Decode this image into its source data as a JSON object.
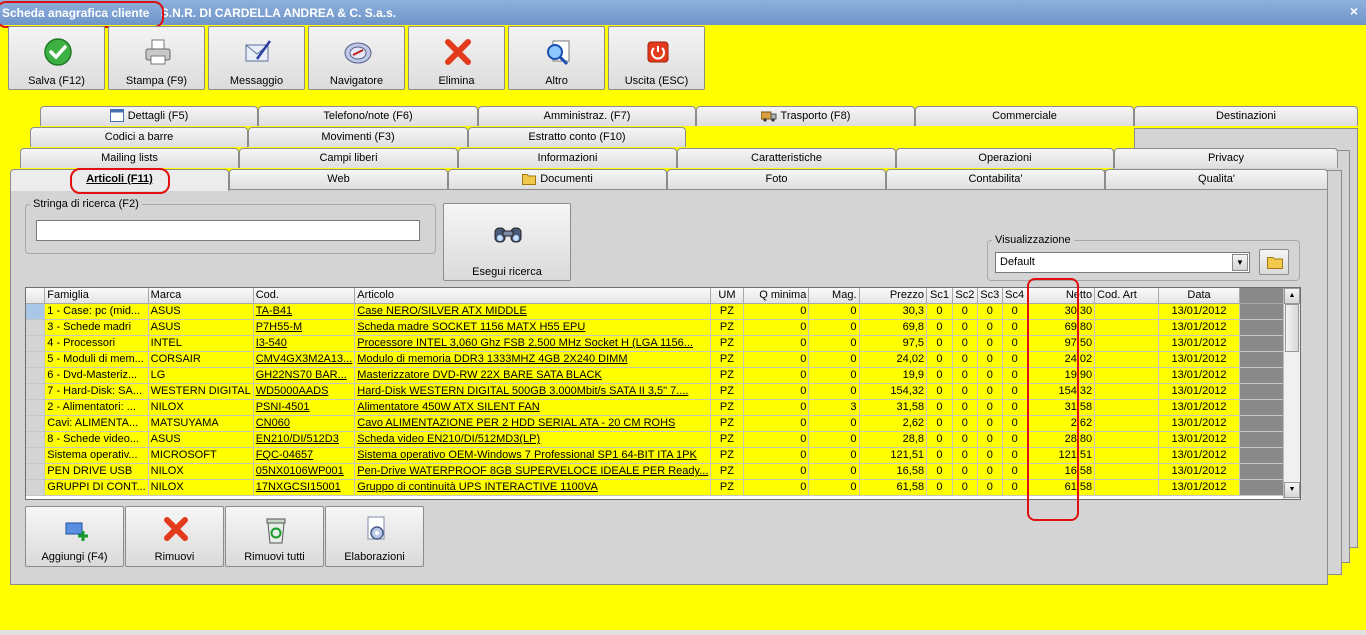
{
  "window": {
    "title": "Scheda anagrafica cliente",
    "company": "S.N.R. DI CARDELLA ANDREA & C. S.a.s.",
    "close_glyph": "×"
  },
  "toolbar": [
    {
      "label": "Salva (F12)",
      "icon": "checkmark-icon"
    },
    {
      "label": "Stampa (F9)",
      "icon": "printer-icon"
    },
    {
      "label": "Messaggio",
      "icon": "message-icon"
    },
    {
      "label": "Navigatore",
      "icon": "navigator-icon"
    },
    {
      "label": "Elimina",
      "icon": "delete-icon"
    },
    {
      "label": "Altro",
      "icon": "search-document-icon"
    },
    {
      "label": "Uscita (ESC)",
      "icon": "power-icon"
    }
  ],
  "tabs": {
    "row1": [
      "Dettagli (F5)",
      "Telefono/note (F6)",
      "Amministraz. (F7)",
      "Trasporto (F8)",
      "Commerciale",
      "Destinazioni"
    ],
    "row2": [
      "Codici a barre",
      "Movimenti (F3)",
      "Estratto conto (F10)"
    ],
    "row3": [
      "Mailing lists",
      "Campi liberi",
      "Informazioni",
      "Caratteristiche",
      "Operazioni",
      "Privacy"
    ],
    "row4": [
      "Articoli (F11)",
      "Web",
      "Documenti",
      "Foto",
      "Contabilita'",
      "Qualita'"
    ]
  },
  "search": {
    "group_label": "Stringa di ricerca (F2)",
    "value": "",
    "button_label": "Esegui ricerca"
  },
  "view": {
    "group_label": "Visualizzazione",
    "selected": "Default",
    "arrow": "▼"
  },
  "grid": {
    "columns": [
      "Famiglia",
      "Marca",
      "Cod.",
      "Articolo",
      "UM",
      "Q minima",
      "Mag.",
      "Prezzo",
      "Sc1",
      "Sc2",
      "Sc3",
      "Sc4",
      "Netto",
      "Cod. Art",
      "Data"
    ],
    "rows": [
      [
        "1 - Case: pc (mid...",
        "ASUS",
        "TA-B41",
        "Case NERO/SILVER ATX MIDDLE",
        "PZ",
        "0",
        "0",
        "30,3",
        "0",
        "0",
        "0",
        "0",
        "30,30",
        "",
        "13/01/2012"
      ],
      [
        "3 - Schede madri",
        "ASUS",
        "P7H55-M",
        "Scheda madre SOCKET 1156 MATX H55 EPU",
        "PZ",
        "0",
        "0",
        "69,8",
        "0",
        "0",
        "0",
        "0",
        "69,80",
        "",
        "13/01/2012"
      ],
      [
        "4 - Processori",
        "INTEL",
        "I3-540",
        "Processore INTEL 3,060 Ghz  FSB 2.500 MHz  Socket H (LGA 1156...",
        "PZ",
        "0",
        "0",
        "97,5",
        "0",
        "0",
        "0",
        "0",
        "97,50",
        "",
        "13/01/2012"
      ],
      [
        "5 - Moduli di mem...",
        "CORSAIR",
        "CMV4GX3M2A13...",
        "Modulo di memoria DDR3 1333MHZ 4GB 2X240 DIMM",
        "PZ",
        "0",
        "0",
        "24,02",
        "0",
        "0",
        "0",
        "0",
        "24,02",
        "",
        "13/01/2012"
      ],
      [
        "6 - Dvd-Masteriz...",
        "LG",
        "GH22NS70  BAR...",
        "Masterizzatore DVD-RW 22X BARE SATA BLACK",
        "PZ",
        "0",
        "0",
        "19,9",
        "0",
        "0",
        "0",
        "0",
        "19,90",
        "",
        "13/01/2012"
      ],
      [
        "7 - Hard-Disk: SA...",
        "WESTERN DIGITAL",
        "WD5000AADS",
        "Hard-Disk WESTERN DIGITAL 500GB 3.000Mbit/s SATA II 3,5\" 7....",
        "PZ",
        "0",
        "0",
        "154,32",
        "0",
        "0",
        "0",
        "0",
        "154,32",
        "",
        "13/01/2012"
      ],
      [
        "2 - Alimentatori: ...",
        "NILOX",
        "PSNI-4501",
        "Alimentatore 450W ATX SILENT FAN",
        "PZ",
        "0",
        "3",
        "31,58",
        "0",
        "0",
        "0",
        "0",
        "31,58",
        "",
        "13/01/2012"
      ],
      [
        "Cavi: ALIMENTA...",
        "MATSUYAMA",
        "CN060",
        "Cavo ALIMENTAZIONE PER 2 HDD SERIAL ATA - 20 CM ROHS",
        "PZ",
        "0",
        "0",
        "2,62",
        "0",
        "0",
        "0",
        "0",
        "2,62",
        "",
        "13/01/2012"
      ],
      [
        "8 - Schede video...",
        "ASUS",
        "EN210/DI/512D3",
        "Scheda video EN210/DI/512MD3(LP)",
        "PZ",
        "0",
        "0",
        "28,8",
        "0",
        "0",
        "0",
        "0",
        "28,80",
        "",
        "13/01/2012"
      ],
      [
        "Sistema operativ...",
        "MICROSOFT",
        "FQC-04657",
        "Sistema operativo OEM-Windows 7 Professional SP1 64-BIT ITA 1PK",
        "PZ",
        "0",
        "0",
        "121,51",
        "0",
        "0",
        "0",
        "0",
        "121,51",
        "",
        "13/01/2012"
      ],
      [
        "PEN DRIVE USB",
        "NILOX",
        "05NX0106WP001",
        "Pen-Drive WATERPROOF 8GB SUPERVELOCE IDEALE PER Ready...",
        "PZ",
        "0",
        "0",
        "16,58",
        "0",
        "0",
        "0",
        "0",
        "16,58",
        "",
        "13/01/2012"
      ],
      [
        "GRUPPI DI CONT...",
        "NILOX",
        "17NXGCSI15001",
        "Gruppo di continuità UPS INTERACTIVE 1100VA",
        "PZ",
        "0",
        "0",
        "61,58",
        "0",
        "0",
        "0",
        "0",
        "61,58",
        "",
        "13/01/2012"
      ]
    ]
  },
  "bottom_buttons": [
    {
      "label": "Aggiungi (F4)",
      "icon": "add-icon"
    },
    {
      "label": "Rimuovi",
      "icon": "remove-icon"
    },
    {
      "label": "Rimuovi tutti",
      "icon": "recycle-bin-icon"
    },
    {
      "label": "Elaborazioni",
      "icon": "processing-icon"
    }
  ],
  "scrollbar": {
    "up": "▲",
    "down": "▼"
  },
  "colors": {
    "background": "#ffff00",
    "titlebar": "#7a9fd2",
    "highlight_oval": "#e01010"
  }
}
